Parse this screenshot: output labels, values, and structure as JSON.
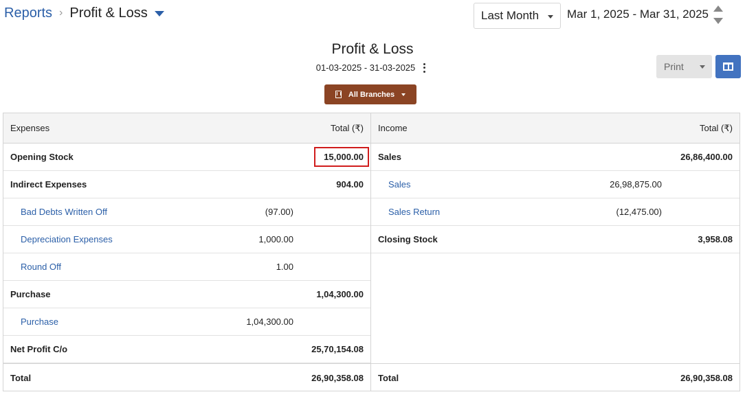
{
  "breadcrumb": {
    "root": "Reports",
    "current": "Profit & Loss"
  },
  "period_select": {
    "value": "Last Month"
  },
  "date_range": "Mar 1, 2025 - Mar 31, 2025",
  "report": {
    "title": "Profit & Loss",
    "dates": "01-03-2025 - 31-03-2025"
  },
  "branches_button": "All Branches",
  "print_button": "Print",
  "colors": {
    "link": "#2b5fa8",
    "branch_button": "#8b4424",
    "layout_button": "#4273c0",
    "highlight": "#d01c1c"
  },
  "icons": {
    "breadcrumb_separator": "chevron-right-icon",
    "title_menu": "caret-down-icon",
    "date_stepper": "up-down-stepper-icon",
    "report_menu": "kebab-menu-icon",
    "branches": "building-icon",
    "layout": "layout-columns-icon"
  },
  "expenses": {
    "header_label": "Expenses",
    "header_total": "Total (₹)",
    "rows": [
      {
        "label": "Opening Stock",
        "total": "15,000.00",
        "highlighted": true
      },
      {
        "label": "Indirect Expenses",
        "total": "904.00"
      },
      {
        "label": "Bad Debts Written Off",
        "value": "(97.00)",
        "sub": true
      },
      {
        "label": "Depreciation Expenses",
        "value": "1,000.00",
        "sub": true
      },
      {
        "label": "Round Off",
        "value": "1.00",
        "sub": true
      },
      {
        "label": "Purchase",
        "total": "1,04,300.00"
      },
      {
        "label": "Purchase",
        "value": "1,04,300.00",
        "sub": true
      },
      {
        "label": "Net Profit C/o",
        "total": "25,70,154.08"
      }
    ],
    "total_label": "Total",
    "total_value": "26,90,358.08"
  },
  "income": {
    "header_label": "Income",
    "header_total": "Total (₹)",
    "rows": [
      {
        "label": "Sales",
        "total": "26,86,400.00"
      },
      {
        "label": "Sales",
        "value": "26,98,875.00",
        "sub": true
      },
      {
        "label": "Sales Return",
        "value": "(12,475.00)",
        "sub": true
      },
      {
        "label": "Closing Stock",
        "total": "3,958.08"
      }
    ],
    "total_label": "Total",
    "total_value": "26,90,358.08"
  }
}
